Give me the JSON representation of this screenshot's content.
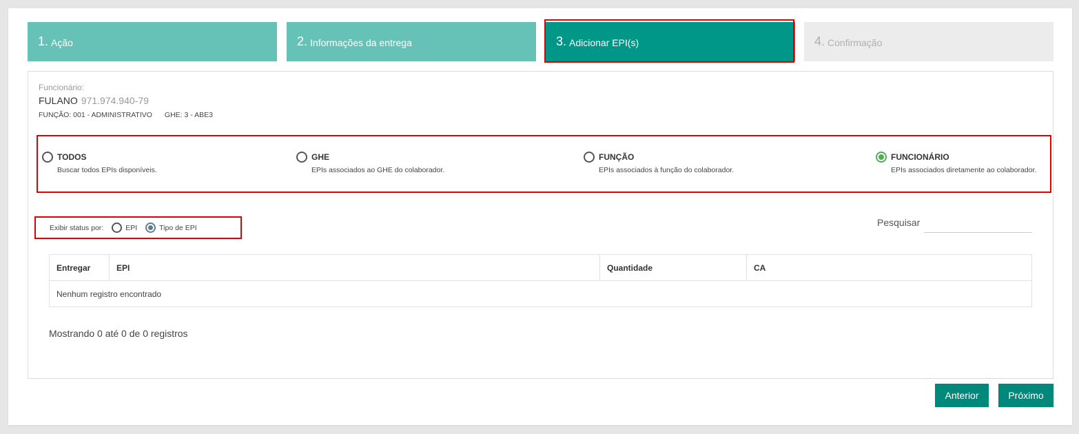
{
  "steps": [
    {
      "num": "1.",
      "label": "Ação"
    },
    {
      "num": "2.",
      "label": "Informações da entrega"
    },
    {
      "num": "3.",
      "label": "Adicionar EPI(s)"
    },
    {
      "num": "4.",
      "label": "Confirmação"
    }
  ],
  "employee": {
    "label": "Funcionário:",
    "name": "FULANO",
    "cpf": "971.974.940-79",
    "function": "FUNÇÃO: 001 - ADMINISTRATIVO",
    "ghe": "GHE: 3 - ABE3"
  },
  "filters": [
    {
      "title": "TODOS",
      "desc": "Buscar todos EPIs disponíveis.",
      "selected": false
    },
    {
      "title": "GHE",
      "desc": "EPIs associados ao GHE do colaborador.",
      "selected": false
    },
    {
      "title": "FUNÇÃO",
      "desc": "EPIs associados à função do colaborador.",
      "selected": false
    },
    {
      "title": "FUNCIONÁRIO",
      "desc": "EPIs associados diretamente ao colaborador.",
      "selected": true
    }
  ],
  "status_display": {
    "label": "Exibir status por:",
    "options": [
      {
        "label": "EPI",
        "selected": false
      },
      {
        "label": "Tipo de EPI",
        "selected": true
      }
    ]
  },
  "search": {
    "label": "Pesquisar",
    "value": ""
  },
  "table": {
    "columns": [
      "Entregar",
      "EPI",
      "Quantidade",
      "CA"
    ],
    "empty_message": "Nenhum registro encontrado"
  },
  "info": "Mostrando 0 até 0 de 0 registros",
  "buttons": {
    "previous": "Anterior",
    "next": "Próximo"
  },
  "colors": {
    "active_step": "#009688",
    "done_step": "#66c2b6",
    "future_step": "#ececec",
    "button": "#00897b",
    "highlight": "#e00000",
    "selected_radio": "#4caf50"
  }
}
